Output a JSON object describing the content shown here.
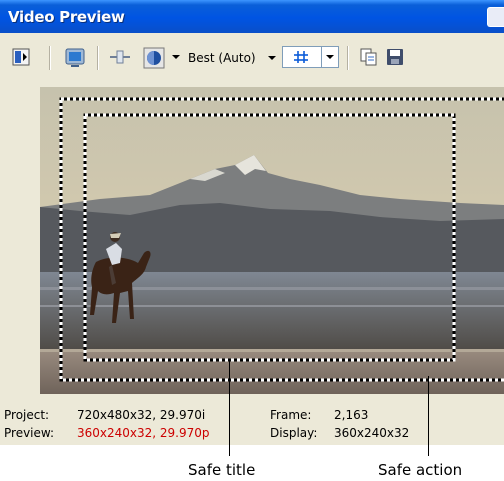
{
  "window": {
    "title": "Video Preview"
  },
  "toolbar": {
    "icons": [
      "preview-device-icon",
      "external-monitor-icon",
      "split-screen-icon",
      "overlay-icon",
      "safe-areas-grid-icon",
      "copy-snapshot-icon",
      "save-snapshot-icon"
    ],
    "quality_label": "Best (Auto)"
  },
  "status": {
    "project_label": "Project:",
    "project_value": "720x480x32, 29.970i",
    "preview_label": "Preview:",
    "preview_value": "360x240x32, 29.970p",
    "preview_value_color": "#cc0000",
    "frame_label": "Frame:",
    "frame_value": "2,163",
    "display_label": "Display:",
    "display_value": "360x240x32"
  },
  "callouts": {
    "safe_title": "Safe title",
    "safe_action": "Safe action"
  },
  "colors": {
    "titlebar": "#0054e3",
    "window_bg": "#ece9d8",
    "grid_accent": "#0b5bd9"
  }
}
